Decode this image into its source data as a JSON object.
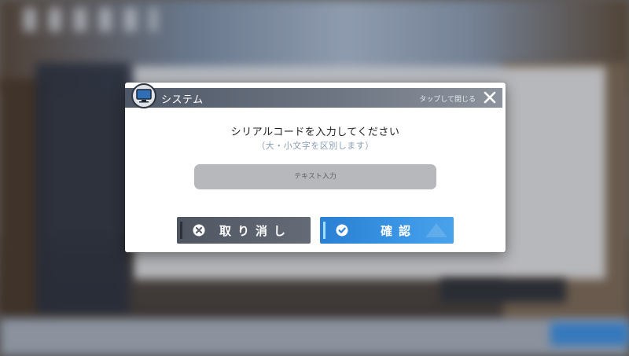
{
  "dialog": {
    "title": "システム",
    "close_hint": "タップして閉じる",
    "headline": "シリアルコードを入力してください",
    "subtext": "（大・小文字を区別します）",
    "input": {
      "placeholder": "テキスト入力",
      "value": ""
    },
    "cancel_label": "取り消し",
    "confirm_label": "確認"
  },
  "icons": {
    "system": "monitor-icon",
    "close": "close-icon",
    "cancel": "cancel-x-icon",
    "confirm": "check-icon"
  },
  "colors": {
    "confirm_button": "#3a95e4",
    "cancel_button": "#5a606b",
    "input_background": "#b6b8bc",
    "subtext": "#8a9cb1"
  }
}
